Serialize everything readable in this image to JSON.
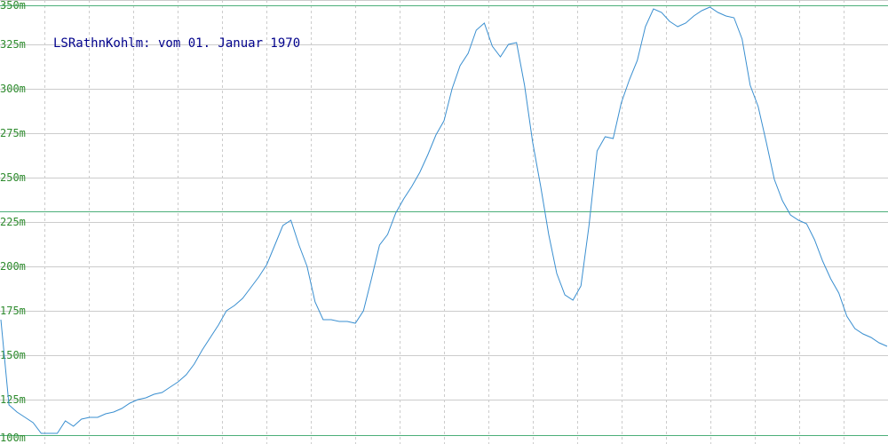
{
  "chart_data": {
    "type": "line",
    "title": "LSRathnKohlm: vom 01. Januar 1970",
    "xlabel": "",
    "ylabel": "",
    "ylim": [
      100,
      350
    ],
    "y_ticks": [
      {
        "value": 100,
        "label": "100m"
      },
      {
        "value": 125,
        "label": "125m"
      },
      {
        "value": 150,
        "label": "150m"
      },
      {
        "value": 175,
        "label": "175m"
      },
      {
        "value": 200,
        "label": "200m"
      },
      {
        "value": 225,
        "label": "225m"
      },
      {
        "value": 250,
        "label": "250m"
      },
      {
        "value": 275,
        "label": "275m"
      },
      {
        "value": 300,
        "label": "300m"
      },
      {
        "value": 325,
        "label": "325m"
      },
      {
        "value": 350,
        "label": "350m"
      }
    ],
    "reference_lines": [
      105,
      231,
      347
    ],
    "grid": true,
    "vertical_gridlines": 20,
    "colors": {
      "line": "#3a8fd0",
      "grid": "#cccccc",
      "reference": "#4caf7a",
      "tick_label": "#2e8b2e",
      "title": "#00008b"
    },
    "series": [
      {
        "values": [
          170,
          122,
          118,
          115,
          112,
          106,
          106,
          106,
          113,
          110,
          114,
          115,
          115,
          117,
          118,
          120,
          123,
          125,
          126,
          128,
          129,
          132,
          135,
          139,
          145,
          153,
          160,
          167,
          175,
          178,
          182,
          188,
          194,
          201,
          212,
          223,
          226,
          212,
          200,
          180,
          170,
          170,
          169,
          169,
          168,
          175,
          193,
          212,
          218,
          230,
          238,
          245,
          253,
          263,
          274,
          282,
          300,
          313,
          320,
          333,
          337,
          324,
          318,
          325,
          326,
          302,
          270,
          245,
          218,
          196,
          184,
          181,
          189,
          223,
          265,
          273,
          272,
          292,
          305,
          316,
          335,
          345,
          343,
          338,
          335,
          337,
          341,
          344,
          346,
          343,
          341,
          340,
          328,
          302,
          290,
          270,
          249,
          237,
          229,
          226,
          224,
          215,
          203,
          193,
          185,
          172,
          165,
          162,
          160,
          157,
          155
        ]
      }
    ]
  }
}
